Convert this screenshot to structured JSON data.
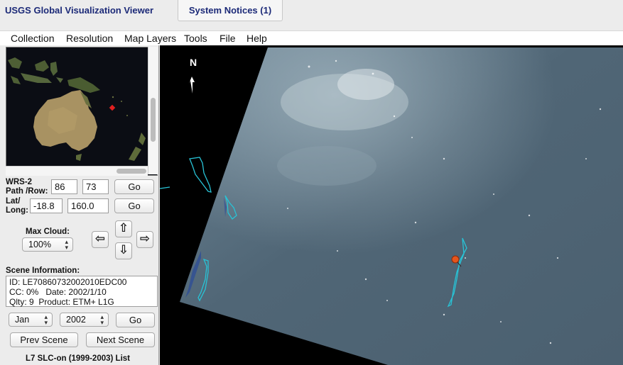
{
  "header": {
    "app_title": "USGS Global Visualization Viewer",
    "notices_tab": "System Notices (1)"
  },
  "menu": [
    "Collection",
    "Resolution",
    "Map Layers",
    "Tools",
    "File",
    "Help"
  ],
  "left": {
    "wrs_label_1": "WRS-2",
    "wrs_label_2": "Path /Row:",
    "path_value": "86",
    "row_value": "73",
    "go_label": "Go",
    "latlong_label_1": "Lat/",
    "latlong_label_2": "Long:",
    "lat_value": "-18.8",
    "long_value": "160.0",
    "max_cloud_label": "Max Cloud:",
    "max_cloud_value": "100%",
    "arrows": {
      "up": "⇧",
      "down": "⇩",
      "left": "⇦",
      "right": "⇨"
    },
    "scene_info_label": "Scene Information:",
    "scene_info": {
      "id_line": "ID: LE70860732002010EDC00",
      "cc_date_line": "CC: 0%   Date: 2002/1/10",
      "qlty_line": "Qlty: 9  Product: ETM+ L1G"
    },
    "month_value": "Jan",
    "year_value": "2002",
    "prev_scene": "Prev Scene",
    "next_scene": "Next Scene",
    "list_label": "L7 SLC-on (1999-2003) List"
  },
  "map": {
    "north_label": "N",
    "colors": {
      "scene_water": "#4f6474",
      "outline": "#28c3d6",
      "marker": "#e5551c"
    }
  }
}
